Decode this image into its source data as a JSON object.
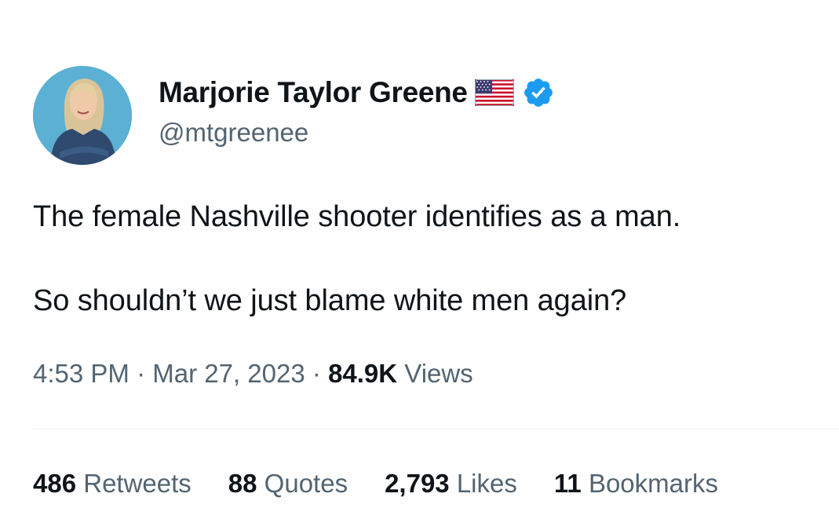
{
  "author": {
    "display_name": "Marjorie Taylor Greene",
    "handle": "@mtgreenee",
    "flag_icon": "us-flag-icon",
    "verified_icon": "verified-badge-icon",
    "verified_color": "#1d9bf0"
  },
  "tweet": {
    "lines": [
      "The female Nashville shooter identifies as a man.",
      "So shouldn’t we just blame white men again?"
    ]
  },
  "meta": {
    "time": "4:53 PM",
    "separator": "·",
    "date": "Mar 27, 2023",
    "views_count": "84.9K",
    "views_label": "Views"
  },
  "stats": [
    {
      "count": "486",
      "label": "Retweets"
    },
    {
      "count": "88",
      "label": "Quotes"
    },
    {
      "count": "2,793",
      "label": "Likes"
    },
    {
      "count": "11",
      "label": "Bookmarks"
    }
  ],
  "colors": {
    "text_primary": "#0f1419",
    "text_secondary": "#536471",
    "divider": "#eff3f4",
    "accent": "#1d9bf0"
  }
}
